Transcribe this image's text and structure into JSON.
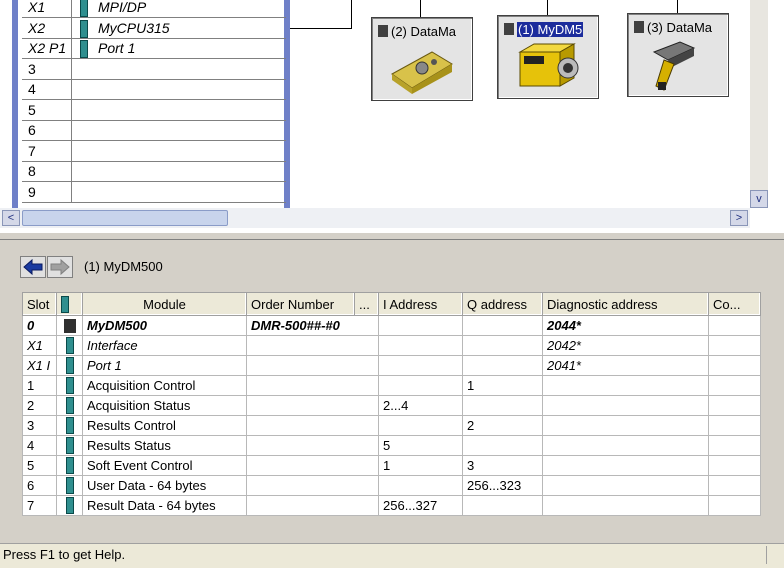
{
  "rack": {
    "rows": [
      {
        "slot": "X1",
        "module": "MPI/DP"
      },
      {
        "slot": "X2",
        "module": "MyCPU315"
      },
      {
        "slot": "X2 P1",
        "module": "Port 1"
      },
      {
        "slot": "3",
        "module": ""
      },
      {
        "slot": "4",
        "module": ""
      },
      {
        "slot": "5",
        "module": ""
      },
      {
        "slot": "6",
        "module": ""
      },
      {
        "slot": "7",
        "module": ""
      },
      {
        "slot": "8",
        "module": ""
      },
      {
        "slot": "9",
        "module": ""
      }
    ]
  },
  "devices": [
    {
      "label": "(2) DataMa",
      "selected": false
    },
    {
      "label": "(1) MyDM5",
      "selected": true
    },
    {
      "label": "(3) DataMa",
      "selected": false
    }
  ],
  "scroll": {
    "left_arrow": "<",
    "right_arrow": ">",
    "down_arrow": "v"
  },
  "detail": {
    "title": "(1)   MyDM500",
    "columns": [
      "Slot",
      "",
      "Module",
      "Order Number",
      "...",
      "I Address",
      "Q address",
      "Diagnostic address",
      "Co..."
    ],
    "rows": [
      {
        "slot": "0",
        "module": "MyDM500",
        "order": "DMR-500##-#0",
        "i": "",
        "q": "",
        "diag": "2044*",
        "style": "bold",
        "icon": "device"
      },
      {
        "slot": "X1",
        "module": "Interface",
        "order": "",
        "i": "",
        "q": "",
        "diag": "2042*",
        "style": "ital",
        "icon": "module"
      },
      {
        "slot": "X1 I",
        "module": "Port 1",
        "order": "",
        "i": "",
        "q": "",
        "diag": "2041*",
        "style": "ital",
        "icon": "module"
      },
      {
        "slot": "1",
        "module": "Acquisition Control",
        "order": "",
        "i": "",
        "q": "1",
        "diag": "",
        "style": "",
        "icon": "module"
      },
      {
        "slot": "2",
        "module": "Acquisition Status",
        "order": "",
        "i": "2...4",
        "q": "",
        "diag": "",
        "style": "",
        "icon": "module"
      },
      {
        "slot": "3",
        "module": "Results Control",
        "order": "",
        "i": "",
        "q": "2",
        "diag": "",
        "style": "",
        "icon": "module"
      },
      {
        "slot": "4",
        "module": "Results Status",
        "order": "",
        "i": "5",
        "q": "",
        "diag": "",
        "style": "",
        "icon": "module"
      },
      {
        "slot": "5",
        "module": "Soft Event Control",
        "order": "",
        "i": "1",
        "q": "3",
        "diag": "",
        "style": "",
        "icon": "module"
      },
      {
        "slot": "6",
        "module": "User Data - 64 bytes",
        "order": "",
        "i": "",
        "q": "256...323",
        "diag": "",
        "style": "",
        "icon": "module"
      },
      {
        "slot": "7",
        "module": "Result Data - 64 bytes",
        "order": "",
        "i": "256...327",
        "q": "",
        "diag": "",
        "style": "",
        "icon": "module"
      }
    ]
  },
  "status": {
    "text": "Press F1 to get Help."
  },
  "colors": {
    "selection": "#1c2c9c",
    "rack_frame": "#6f80c8",
    "module_icon": "#2f8f8f"
  }
}
